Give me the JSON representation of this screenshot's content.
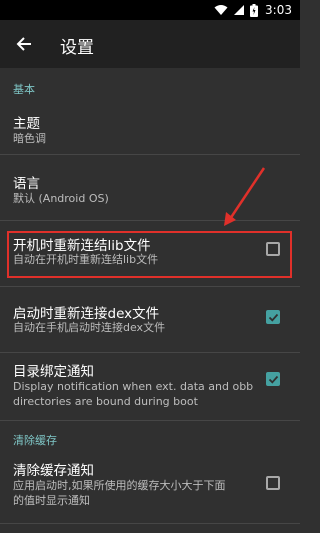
{
  "status_bar": {
    "time": "3:03",
    "icons": [
      "wifi-icon",
      "signal-icon",
      "battery-icon"
    ]
  },
  "toolbar": {
    "back_icon": "arrow-back-icon",
    "title": "设置"
  },
  "sections": {
    "basic": {
      "header": "基本"
    },
    "cache": {
      "header": "清除缓存"
    }
  },
  "prefs": {
    "theme": {
      "title": "主题",
      "summary": "暗色调"
    },
    "language": {
      "title": "语言",
      "summary": "默认 (Android OS)"
    },
    "relink_lib": {
      "title": "开机时重新连结lib文件",
      "summary": "自动在开机时重新连结lib文件",
      "checked": false
    },
    "relink_dex": {
      "title": "启动时重新连接dex文件",
      "summary": "自动在手机启动时连接dex文件",
      "checked": true
    },
    "dir_notify": {
      "title": "目录绑定通知",
      "summary_line1": "Display notification when ext. data and obb",
      "summary_line2": "directories are bound during boot",
      "checked": true
    },
    "clear_cache": {
      "title": "清除缓存通知",
      "summary_line1": "应用启动时,如果所使用的缓存大小大于下面",
      "summary_line2": "的值时显示通知",
      "checked": false
    }
  },
  "colors": {
    "background": "#303030",
    "toolbar": "#212121",
    "accent": "#45a1a1",
    "section_header": "#7fc6c6",
    "annotation": "#e0302a"
  }
}
